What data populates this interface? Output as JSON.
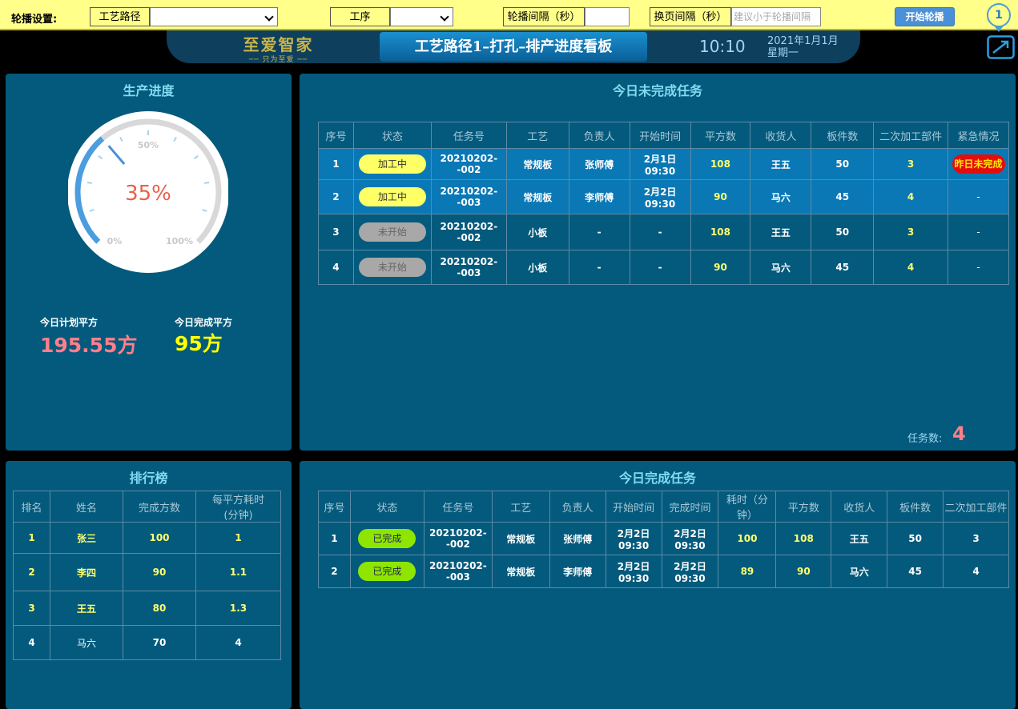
{
  "topbar": {
    "label": "轮播设置:",
    "route_label": "工艺路径",
    "route_value": "",
    "process_label": "工序",
    "process_value": "",
    "interval_label": "轮播间隔（秒）",
    "interval_value": "",
    "page_interval_label": "换页间隔（秒）",
    "page_interval_placeholder": "建议小于轮播间隔",
    "start_button": "开始轮播",
    "pin_number": "1"
  },
  "header": {
    "logo_text": "至爱智家",
    "logo_slogan": "── 只为至爱 ──",
    "title": "工艺路径1–打孔–排产进度看板",
    "time": "10:10",
    "date": "2021年1月1月",
    "weekday": "星期一"
  },
  "progress": {
    "title": "生产进度",
    "percent_text": "35%",
    "percent_value": 35,
    "tick_0": "0%",
    "tick_50": "50%",
    "tick_100": "100%",
    "plan_label": "今日计划平方",
    "plan_value": "195.55方",
    "done_label": "今日完成平方",
    "done_value": "95方",
    "colors": {
      "gauge_fill": "#4a90d9",
      "plan": "#ff7f8a",
      "done": "#ffff00"
    }
  },
  "pending": {
    "title": "今日未完成任务",
    "headers": [
      "序号",
      "状态",
      "任务号",
      "工艺",
      "负责人",
      "开始时间",
      "平方数",
      "收货人",
      "板件数",
      "二次加工部件",
      "紧急情况"
    ],
    "rows": [
      {
        "no": "1",
        "status": "加工中",
        "task": "20210202--002",
        "craft": "常规板",
        "owner": "张师傅",
        "start": "2月1日\n09:30",
        "area": "108",
        "receiver": "王五",
        "boards": "50",
        "second": "3",
        "urgent": "昨日未完成"
      },
      {
        "no": "2",
        "status": "加工中",
        "task": "20210202--003",
        "craft": "常规板",
        "owner": "李师傅",
        "start": "2月2日\n09:30",
        "area": "90",
        "receiver": "马六",
        "boards": "45",
        "second": "4",
        "urgent": "-"
      },
      {
        "no": "3",
        "status": "未开始",
        "task": "20210202--002",
        "craft": "小板",
        "owner": "-",
        "start": "-",
        "area": "108",
        "receiver": "王五",
        "boards": "50",
        "second": "3",
        "urgent": "-"
      },
      {
        "no": "4",
        "status": "未开始",
        "task": "20210202--003",
        "craft": "小板",
        "owner": "-",
        "start": "-",
        "area": "90",
        "receiver": "马六",
        "boards": "45",
        "second": "4",
        "urgent": "-"
      }
    ],
    "count_label": "任务数:",
    "count_value": "4"
  },
  "ranking": {
    "title": "排行榜",
    "headers": [
      "排名",
      "姓名",
      "完成方数",
      "每平方耗时\n(分钟)"
    ],
    "rows": [
      {
        "rank": "1",
        "name": "张三",
        "done": "100",
        "time": "1"
      },
      {
        "rank": "2",
        "name": "李四",
        "done": "90",
        "time": "1.1"
      },
      {
        "rank": "3",
        "name": "王五",
        "done": "80",
        "time": "1.3"
      },
      {
        "rank": "4",
        "name": "马六",
        "done": "70",
        "time": "4"
      }
    ]
  },
  "completed": {
    "title": "今日完成任务",
    "headers": [
      "序号",
      "状态",
      "任务号",
      "工艺",
      "负责人",
      "开始时间",
      "完成时间",
      "耗时（分\n钟）",
      "平方数",
      "收货人",
      "板件数",
      "二次加工部件"
    ],
    "rows": [
      {
        "no": "1",
        "status": "已完成",
        "task": "20210202-\n-002",
        "craft": "常规板",
        "owner": "张师傅",
        "start": "2月2日\n09:30",
        "end": "2月2日\n09:30",
        "cost": "100",
        "area": "108",
        "receiver": "王五",
        "boards": "50",
        "second": "3"
      },
      {
        "no": "2",
        "status": "已完成",
        "task": "20210202-\n-003",
        "craft": "常规板",
        "owner": "李师傅",
        "start": "2月2日\n09:30",
        "end": "2月2日\n09:30",
        "cost": "89",
        "area": "90",
        "receiver": "马六",
        "boards": "45",
        "second": "4"
      }
    ]
  }
}
